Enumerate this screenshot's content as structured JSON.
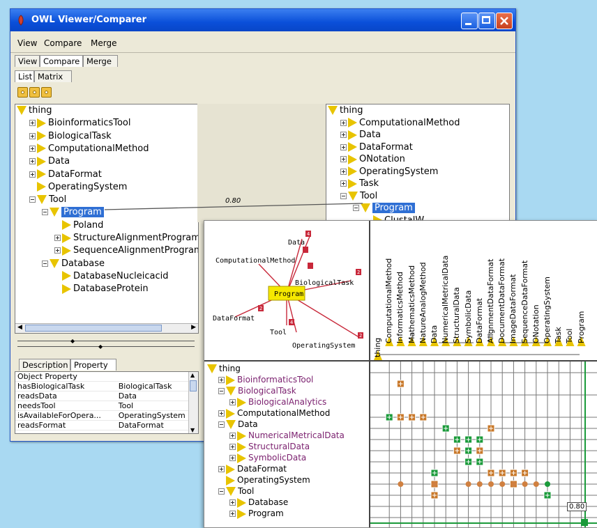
{
  "window": {
    "title": "OWL Viewer/Comparer"
  },
  "menu": [
    "View",
    "Compare",
    "Merge"
  ],
  "main_tabs": [
    "View",
    "Compare",
    "Merge"
  ],
  "sub_tabs": [
    "List",
    "Matrix"
  ],
  "left_tree": [
    {
      "label": "thing",
      "depth": 0,
      "expanded": true,
      "plus": false
    },
    {
      "label": "BioinformaticsTool",
      "depth": 1,
      "expanded": false,
      "plus": true
    },
    {
      "label": "BiologicalTask",
      "depth": 1,
      "expanded": false,
      "plus": true
    },
    {
      "label": "ComputationalMethod",
      "depth": 1,
      "expanded": false,
      "plus": true
    },
    {
      "label": "Data",
      "depth": 1,
      "expanded": false,
      "plus": true
    },
    {
      "label": "DataFormat",
      "depth": 1,
      "expanded": false,
      "plus": true
    },
    {
      "label": "OperatingSystem",
      "depth": 1,
      "expanded": false,
      "plus": false
    },
    {
      "label": "Tool",
      "depth": 1,
      "expanded": true,
      "plus": true
    },
    {
      "label": "Program",
      "depth": 2,
      "expanded": true,
      "plus": true,
      "selected": true
    },
    {
      "label": "Poland",
      "depth": 3,
      "expanded": false,
      "plus": false
    },
    {
      "label": "StructureAlignmentProgram",
      "depth": 3,
      "expanded": false,
      "plus": true
    },
    {
      "label": "SequenceAlignmentProgram",
      "depth": 3,
      "expanded": false,
      "plus": true
    },
    {
      "label": "Database",
      "depth": 2,
      "expanded": true,
      "plus": true
    },
    {
      "label": "DatabaseNucleicacid",
      "depth": 3,
      "expanded": false,
      "plus": false
    },
    {
      "label": "DatabaseProtein",
      "depth": 3,
      "expanded": false,
      "plus": false
    }
  ],
  "right_tree": [
    {
      "label": "thing",
      "depth": 0,
      "expanded": true,
      "plus": false
    },
    {
      "label": "ComputationalMethod",
      "depth": 1,
      "expanded": false,
      "plus": true
    },
    {
      "label": "Data",
      "depth": 1,
      "expanded": false,
      "plus": true
    },
    {
      "label": "DataFormat",
      "depth": 1,
      "expanded": false,
      "plus": true
    },
    {
      "label": "ONotation",
      "depth": 1,
      "expanded": false,
      "plus": true
    },
    {
      "label": "OperatingSystem",
      "depth": 1,
      "expanded": false,
      "plus": true
    },
    {
      "label": "Task",
      "depth": 1,
      "expanded": false,
      "plus": true
    },
    {
      "label": "Tool",
      "depth": 1,
      "expanded": true,
      "plus": true
    },
    {
      "label": "Program",
      "depth": 2,
      "expanded": true,
      "plus": true,
      "selected": true
    },
    {
      "label": "ClustalW",
      "depth": 3,
      "expanded": false,
      "plus": false
    }
  ],
  "match_score": "0.80",
  "bottom_tabs": [
    "Description",
    "Property"
  ],
  "property_table": {
    "header": "Object Property",
    "rows": [
      [
        "hasBiologicalTask",
        "BiologicalTask"
      ],
      [
        "readsData",
        "Data"
      ],
      [
        "needsTool",
        "Tool"
      ],
      [
        "isAvailableForOpera...",
        "OperatingSystem"
      ],
      [
        "readsFormat",
        "DataFormat"
      ]
    ]
  },
  "radial_graph": {
    "center": "Program",
    "nodes": [
      {
        "label": "Data",
        "count": "4"
      },
      {
        "label": "ComputationalMethod",
        "count": ""
      },
      {
        "label": "BiologicalTask",
        "count": "2"
      },
      {
        "label": "DataFormat",
        "count": "2"
      },
      {
        "label": "Tool",
        "count": "4"
      },
      {
        "label": "OperatingSystem",
        "count": "2"
      }
    ]
  },
  "matrix_columns": [
    "thing",
    "ComputationalMethod",
    "InformaticsMethod",
    "MathematicsMethod",
    "NatureAnalogMethod",
    "Data",
    "NumericalMetricalData",
    "StructuralData",
    "SymbolicData",
    "DataFormat",
    "AlignmentDataFormat",
    "DocumentDataFormat",
    "ImageDataFormat",
    "SequenceDataFormat",
    "ONotation",
    "OperatingSystem",
    "Task",
    "Tool",
    "Program"
  ],
  "bottom_tree": [
    {
      "label": "thing",
      "depth": 0,
      "expanded": true,
      "plus": false,
      "purple": false
    },
    {
      "label": "BioinformaticsTool",
      "depth": 1,
      "expanded": false,
      "plus": true,
      "purple": true
    },
    {
      "label": "BiologicalTask",
      "depth": 1,
      "expanded": true,
      "plus": true,
      "purple": true
    },
    {
      "label": "BiologicalAnalytics",
      "depth": 2,
      "expanded": false,
      "plus": true,
      "purple": true
    },
    {
      "label": "ComputationalMethod",
      "depth": 1,
      "expanded": false,
      "plus": true,
      "purple": false
    },
    {
      "label": "Data",
      "depth": 1,
      "expanded": true,
      "plus": true,
      "purple": false
    },
    {
      "label": "NumericalMetricalData",
      "depth": 2,
      "expanded": false,
      "plus": true,
      "purple": true
    },
    {
      "label": "StructuralData",
      "depth": 2,
      "expanded": false,
      "plus": true,
      "purple": true
    },
    {
      "label": "SymbolicData",
      "depth": 2,
      "expanded": false,
      "plus": true,
      "purple": true
    },
    {
      "label": "DataFormat",
      "depth": 1,
      "expanded": false,
      "plus": true,
      "purple": false
    },
    {
      "label": "OperatingSystem",
      "depth": 1,
      "expanded": false,
      "plus": false,
      "purple": false
    },
    {
      "label": "Tool",
      "depth": 1,
      "expanded": true,
      "plus": true,
      "purple": false
    },
    {
      "label": "Database",
      "depth": 2,
      "expanded": false,
      "plus": true,
      "purple": false
    },
    {
      "label": "Program",
      "depth": 2,
      "expanded": false,
      "plus": true,
      "purple": false
    }
  ],
  "matrix_score": "0.80",
  "colors": {
    "accent": "#2f6fd4",
    "node": "#e8c400",
    "match_green": "#1a9a3a",
    "match_orange": "#c8782a",
    "edge_red": "#c8283a"
  }
}
